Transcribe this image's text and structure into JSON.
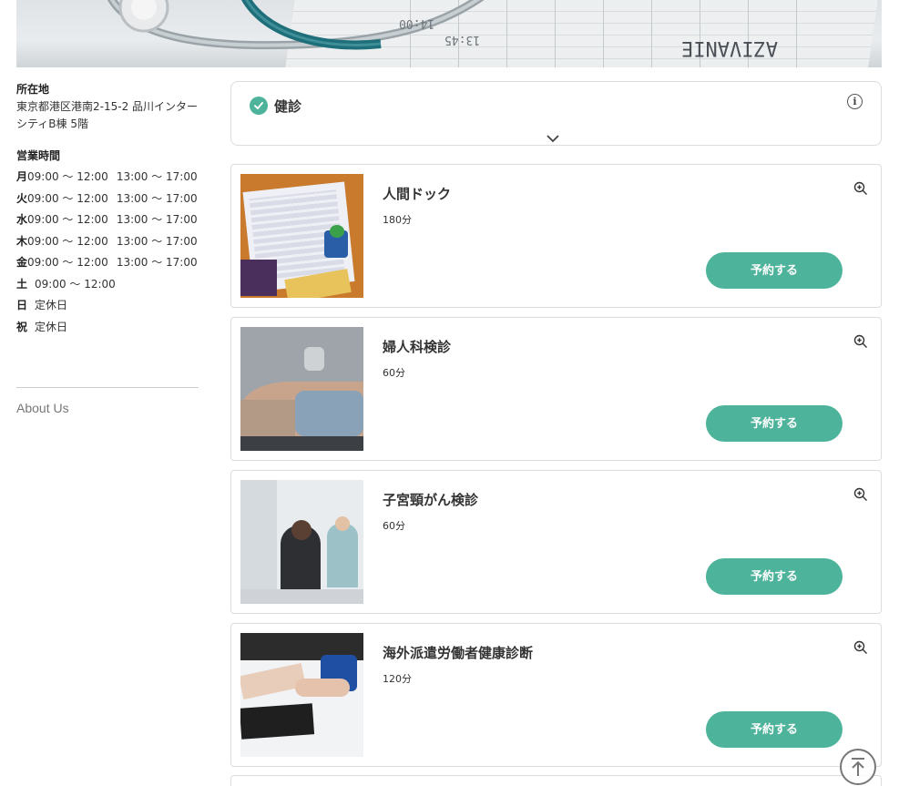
{
  "sidebar": {
    "location_heading": "所在地",
    "address": "東京都港区港南2-15-2 品川インターシティB棟 5階",
    "hours_heading": "営業時間",
    "hours": [
      {
        "day": "月",
        "slots": [
          "09:00 〜 12:00",
          "13:00 〜 17:00"
        ]
      },
      {
        "day": "火",
        "slots": [
          "09:00 〜 12:00",
          "13:00 〜 17:00"
        ]
      },
      {
        "day": "水",
        "slots": [
          "09:00 〜 12:00",
          "13:00 〜 17:00"
        ]
      },
      {
        "day": "木",
        "slots": [
          "09:00 〜 12:00",
          "13:00 〜 17:00"
        ]
      },
      {
        "day": "金",
        "slots": [
          "09:00 〜 12:00",
          "13:00 〜 17:00"
        ]
      },
      {
        "day": "土",
        "slots": [
          "09:00 〜 12:00",
          ""
        ]
      },
      {
        "day": "日",
        "slots": [
          "定休日",
          ""
        ]
      },
      {
        "day": "祝",
        "slots": [
          "定休日",
          ""
        ]
      }
    ],
    "about_link": "About Us"
  },
  "category": {
    "title": "健診",
    "icons": [
      "check-circle-icon",
      "info-icon",
      "chevron-down-icon"
    ]
  },
  "courses": [
    {
      "title": "人間ドック",
      "duration": "180分",
      "button": "予約する"
    },
    {
      "title": "婦人科検診",
      "duration": "60分",
      "button": "予約する"
    },
    {
      "title": "子宮頸がん検診",
      "duration": "60分",
      "button": "予約する"
    },
    {
      "title": "海外派遣労働者健康診断",
      "duration": "120分",
      "button": "予約する"
    }
  ],
  "colors": {
    "accent": "#4db39a",
    "border": "#dcdcdc",
    "text": "#333333"
  }
}
